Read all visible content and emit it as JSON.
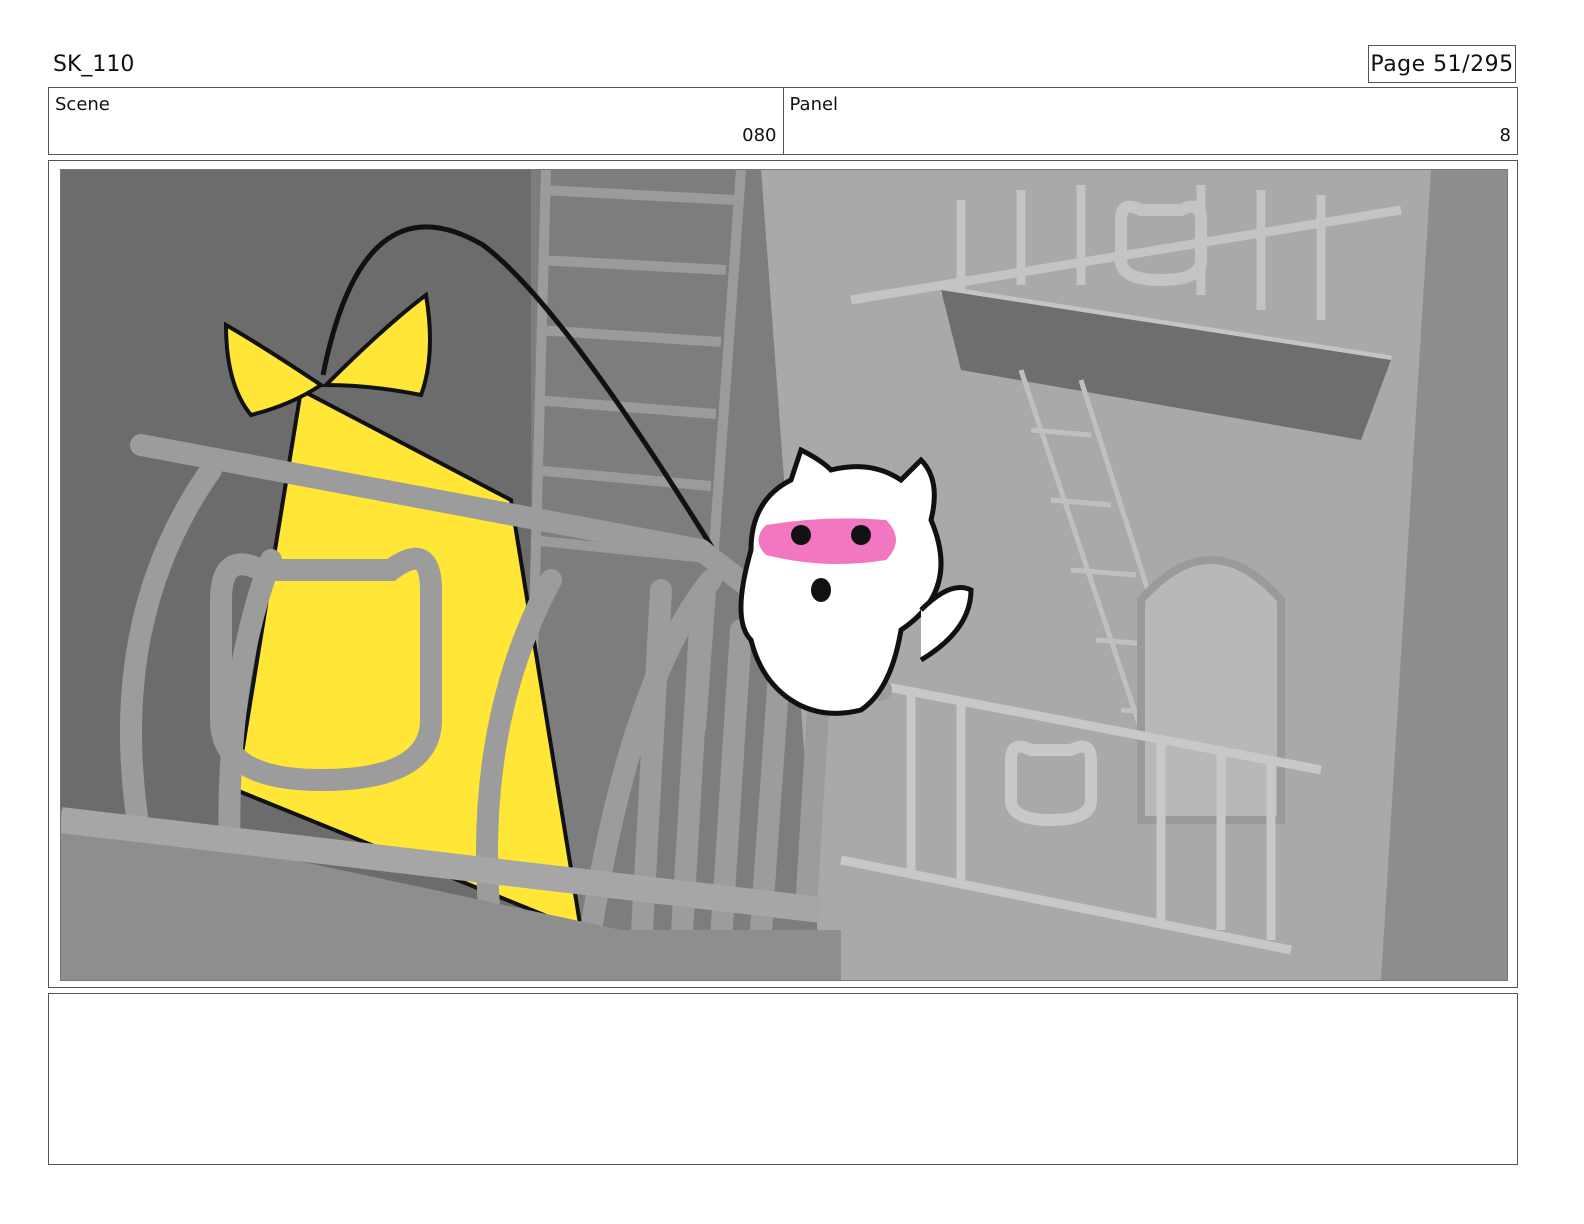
{
  "header": {
    "sheet_id": "SK_110",
    "page_label": "Page  51/295"
  },
  "info": {
    "scene_label": "Scene",
    "scene_value": "080",
    "panel_label": "Panel",
    "panel_value": "8"
  },
  "frame": {
    "description_icons": [
      "present-icon",
      "cat-character-icon",
      "balcony-railing-icon",
      "fire-escape-ladder-icon"
    ],
    "colors": {
      "present_yellow": "#FFE637",
      "mask_pink": "#F277C0",
      "wall_gray": "#A8A8A8",
      "shadow_gray": "#6E6E6E"
    }
  },
  "notes": {
    "text": ""
  }
}
